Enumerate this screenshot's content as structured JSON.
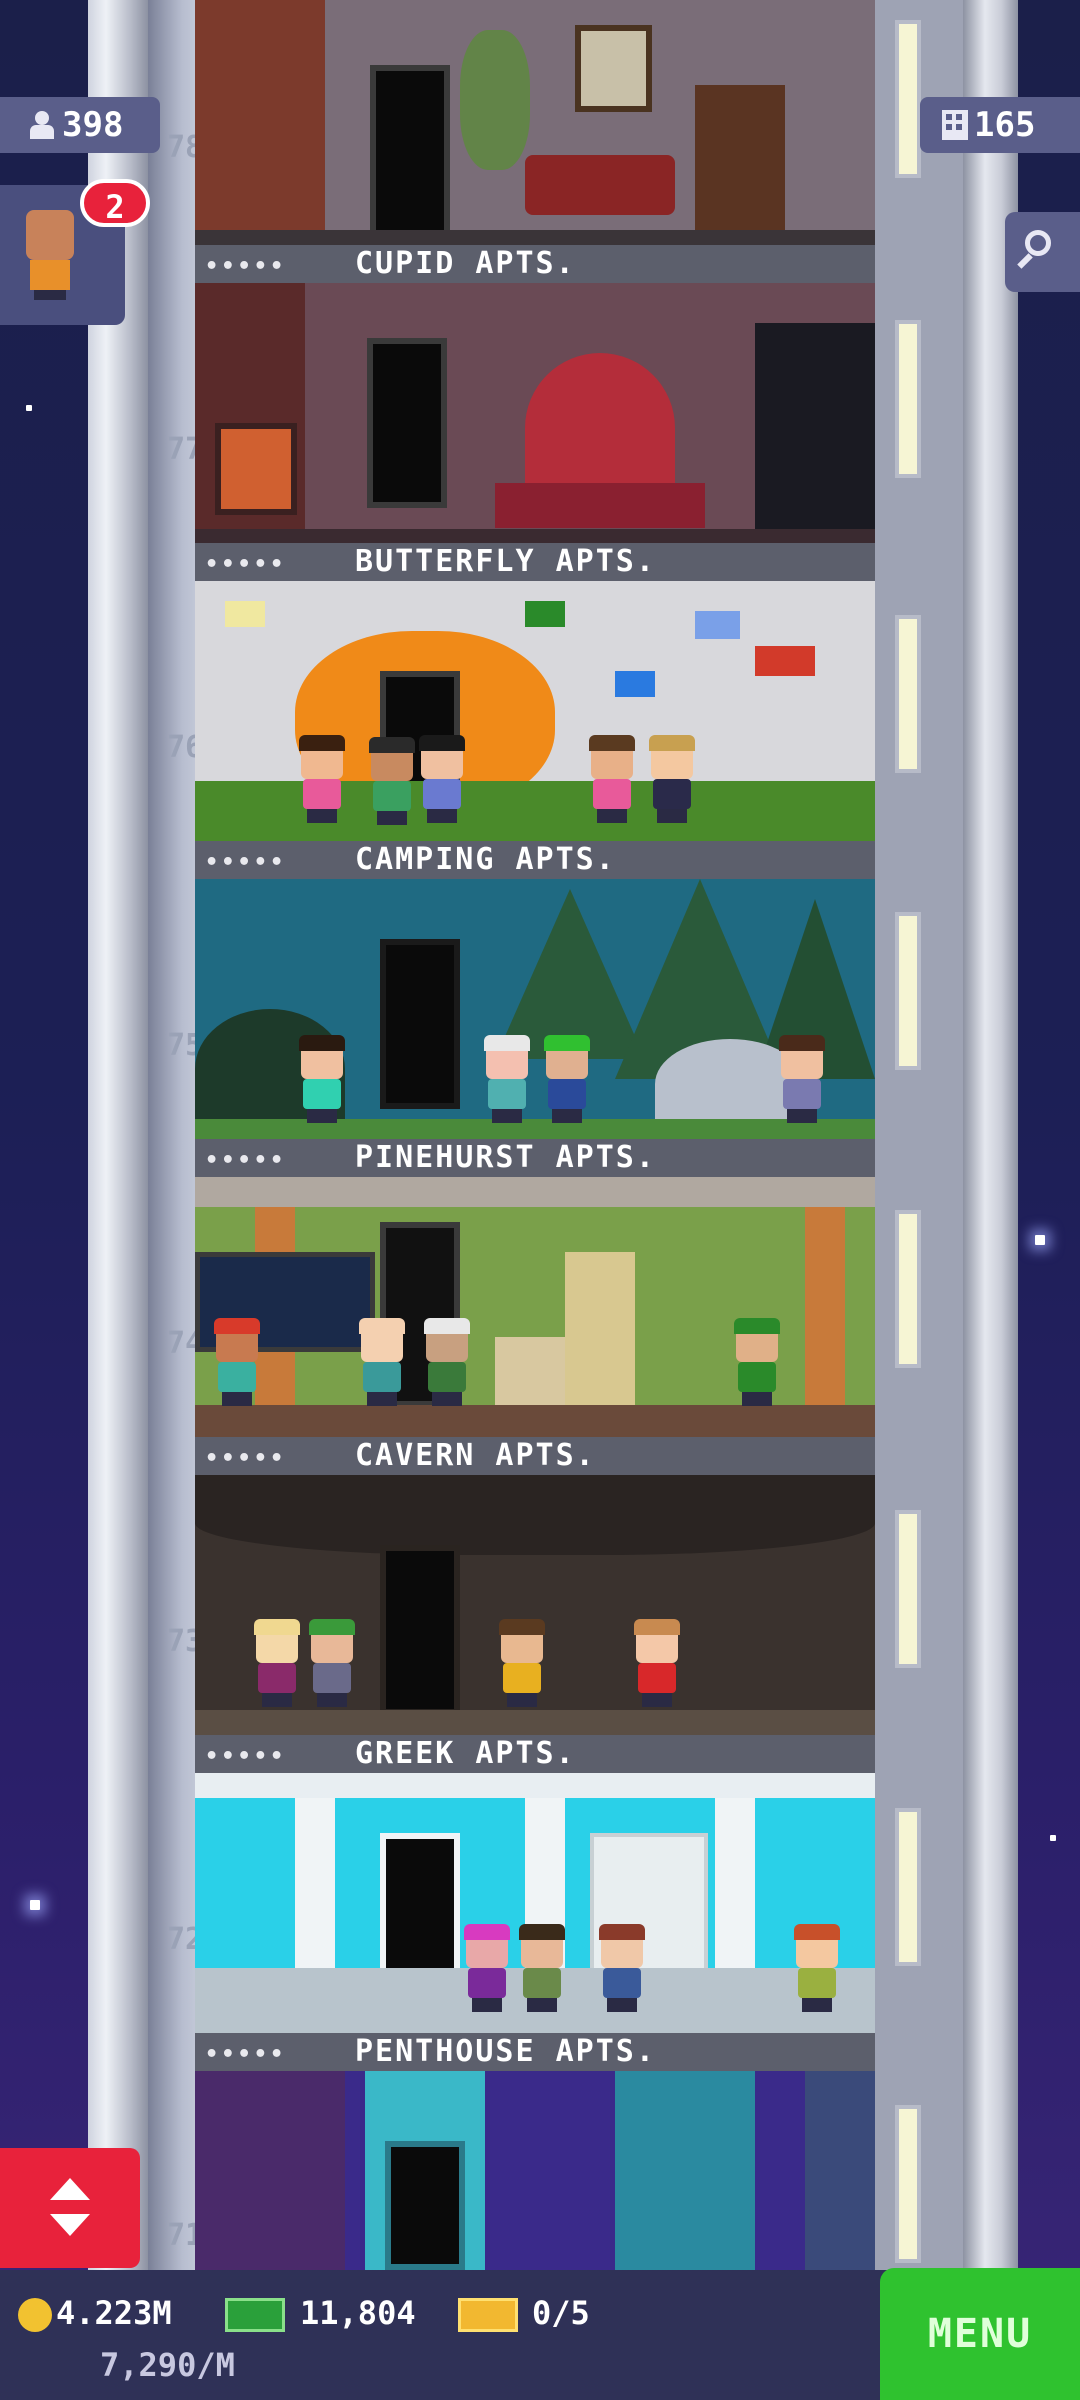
{
  "hud": {
    "population": "398",
    "floors": "165",
    "notification_count": "2",
    "coins": "4.223M",
    "coin_rate": "7,290/M",
    "bux": "11,804",
    "tickets": "0/5",
    "menu_label": "MENU"
  },
  "elevator_floor_numbers": [
    "78",
    "77",
    "76",
    "75",
    "74",
    "73",
    "72",
    "71"
  ],
  "floors": [
    {
      "name": "CUPID APTS."
    },
    {
      "name": "BUTTERFLY APTS."
    },
    {
      "name": "CAMPING APTS."
    },
    {
      "name": "PINEHURST APTS."
    },
    {
      "name": "CAVERN APTS."
    },
    {
      "name": "GREEK APTS."
    },
    {
      "name": "PENTHOUSE APTS."
    }
  ],
  "rating_dots": "•••••",
  "colors": {
    "accent_green": "#2fc22f",
    "elevator_red": "#e8223b",
    "notification_red": "#e8223b",
    "hud_bar": "#2f3157"
  },
  "icons": [
    "population-icon",
    "floors-icon",
    "search-icon",
    "coin-icon",
    "bux-icon",
    "ticket-icon",
    "elevator-updown-icon"
  ]
}
